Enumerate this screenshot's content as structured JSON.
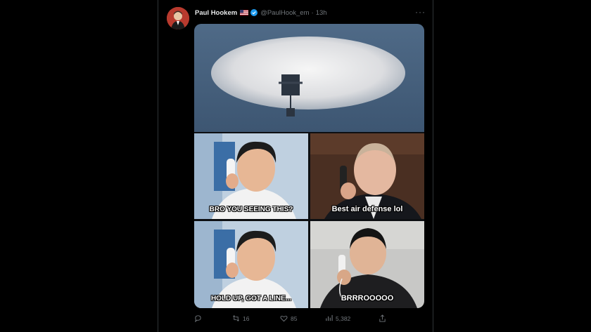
{
  "tweet": {
    "author_name": "Paul Hookem",
    "handle": "@PaulHook_em",
    "separator": "·",
    "time": "13h",
    "flag_icon": "us-flag-icon",
    "verified_icon": "verified-badge-icon",
    "more_label": "···"
  },
  "media": {
    "panels": [
      {
        "caption": ""
      },
      {
        "caption": "BRO YOU SEEING THIS?"
      },
      {
        "caption": "Best air defense lol"
      },
      {
        "caption": "HOLD UP, GOT A LINE..."
      },
      {
        "caption": "BRRROOOOO"
      }
    ]
  },
  "actions": {
    "reply": {
      "icon": "reply-icon",
      "count": ""
    },
    "retweet": {
      "icon": "retweet-icon",
      "count": "16"
    },
    "like": {
      "icon": "heart-icon",
      "count": "85"
    },
    "views": {
      "icon": "analytics-icon",
      "count": "5,382"
    },
    "share": {
      "icon": "share-icon",
      "count": ""
    }
  },
  "colors": {
    "background": "#000000",
    "border": "#2f3336",
    "text_primary": "#e7e9ea",
    "text_secondary": "#71767b",
    "verified_blue": "#1d9bf0"
  }
}
